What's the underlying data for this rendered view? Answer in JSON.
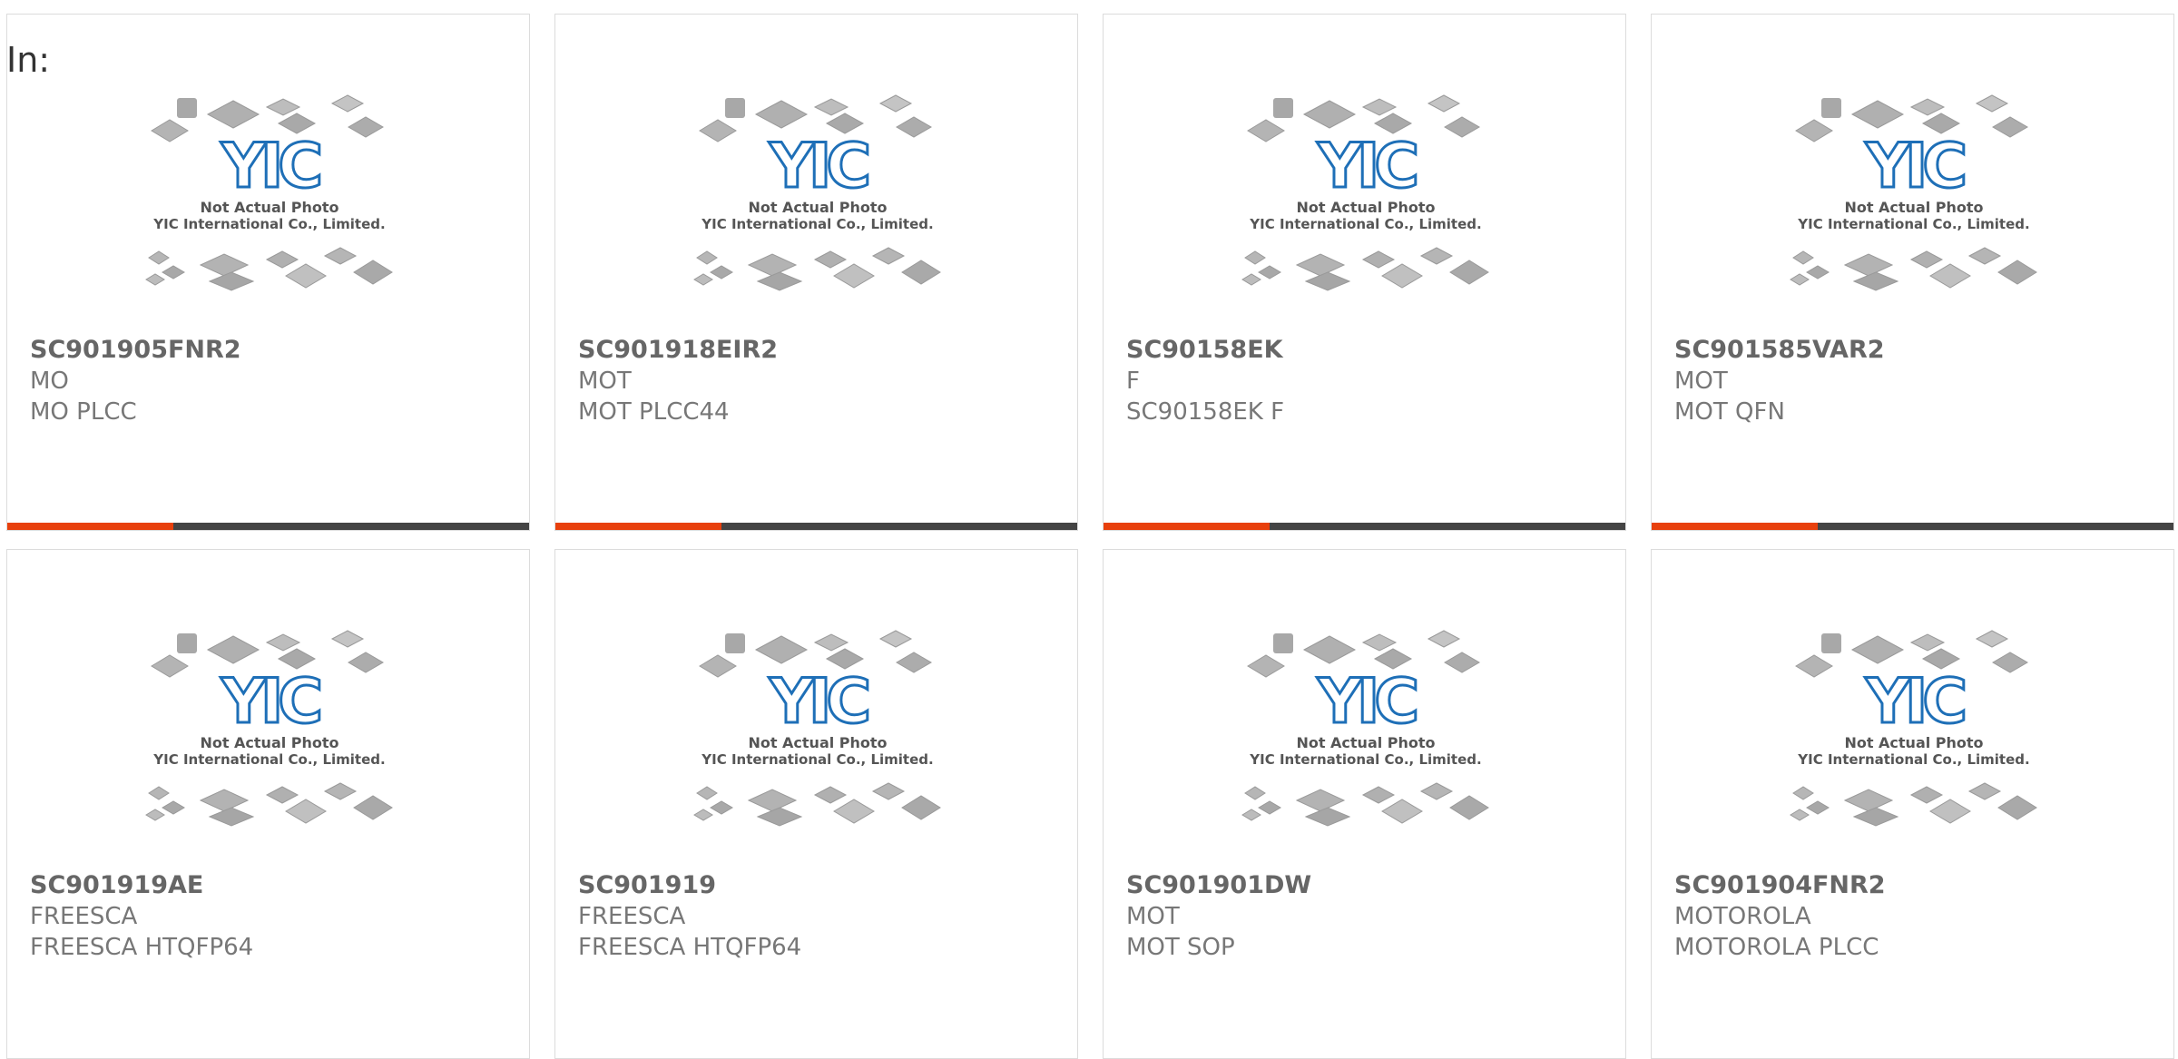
{
  "header": {
    "in_label": "In:"
  },
  "colors": {
    "accent": "#e8400c",
    "bar_dark": "#444444",
    "logo_blue": "#1e6fb7"
  },
  "placeholder": {
    "line1": "Not Actual Photo",
    "line2": "YIC International Co., Limited.",
    "logo_text": "YIC"
  },
  "products": [
    {
      "part": "SC901905FNR2",
      "brand": "MO",
      "desc": "MO PLCC"
    },
    {
      "part": "SC901918EIR2",
      "brand": "MOT",
      "desc": "MOT PLCC44"
    },
    {
      "part": "SC90158EK",
      "brand": "F",
      "desc": "SC90158EK F"
    },
    {
      "part": "SC901585VAR2",
      "brand": "MOT",
      "desc": "MOT QFN"
    },
    {
      "part": "SC901919AE",
      "brand": "FREESCA",
      "desc": "FREESCA HTQFP64"
    },
    {
      "part": "SC901919",
      "brand": "FREESCA",
      "desc": "FREESCA HTQFP64"
    },
    {
      "part": "SC901901DW",
      "brand": "MOT",
      "desc": "MOT SOP"
    },
    {
      "part": "SC901904FNR2",
      "brand": "MOTOROLA",
      "desc": "MOTOROLA PLCC"
    }
  ]
}
